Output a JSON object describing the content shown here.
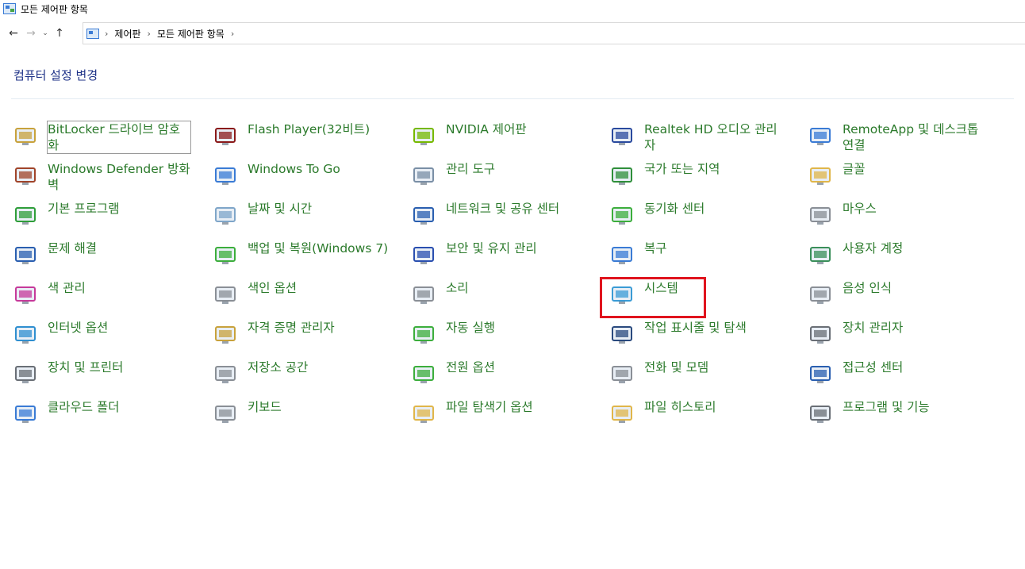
{
  "window": {
    "title": "모든 제어판 항목"
  },
  "nav": {
    "back_glyph": "←",
    "forward_glyph": "→",
    "recent_glyph": "⌄",
    "up_glyph": "↑"
  },
  "breadcrumb": {
    "items": [
      "제어판",
      "모든 제어판 항목"
    ],
    "sep": "›"
  },
  "heading": "컴퓨터 설정 변경",
  "items": [
    {
      "label": "BitLocker 드라이브 암호화",
      "icon": "bitlocker-icon",
      "color": "#c8a23c"
    },
    {
      "label": "Flash Player(32비트)",
      "icon": "flash-icon",
      "color": "#8b1a1a"
    },
    {
      "label": "NVIDIA 제어판",
      "icon": "nvidia-icon",
      "color": "#76b900"
    },
    {
      "label": "Realtek HD 오디오 관리자",
      "icon": "realtek-icon",
      "color": "#2a4a9e"
    },
    {
      "label": "RemoteApp 및 데스크톱 연결",
      "icon": "remoteapp-icon",
      "color": "#3a7bd5"
    },
    {
      "label": "Windows Defender 방화벽",
      "icon": "firewall-icon",
      "color": "#a0442a"
    },
    {
      "label": "Windows To Go",
      "icon": "windows-to-go-icon",
      "color": "#3a7bd5"
    },
    {
      "label": "관리 도구",
      "icon": "admin-tools-icon",
      "color": "#7a8fa6"
    },
    {
      "label": "국가 또는 지역",
      "icon": "region-icon",
      "color": "#2f8f3a"
    },
    {
      "label": "글꼴",
      "icon": "fonts-icon",
      "color": "#e0b64a"
    },
    {
      "label": "기본 프로그램",
      "icon": "default-programs-icon",
      "color": "#2f9e3a"
    },
    {
      "label": "날짜 및 시간",
      "icon": "date-time-icon",
      "color": "#7fa6c9"
    },
    {
      "label": "네트워크 및 공유 센터",
      "icon": "network-icon",
      "color": "#2a5fb0"
    },
    {
      "label": "동기화 센터",
      "icon": "sync-center-icon",
      "color": "#3cae3c"
    },
    {
      "label": "마우스",
      "icon": "mouse-icon",
      "color": "#8a8f96"
    },
    {
      "label": "문제 해결",
      "icon": "troubleshoot-icon",
      "color": "#2a5fb0"
    },
    {
      "label": "백업 및 복원(Windows 7)",
      "icon": "backup-icon",
      "color": "#3cae3c"
    },
    {
      "label": "보안 및 유지 관리",
      "icon": "security-flag-icon",
      "color": "#2a4fb0"
    },
    {
      "label": "복구",
      "icon": "recovery-icon",
      "color": "#3a7bd5"
    },
    {
      "label": "사용자 계정",
      "icon": "user-accounts-icon",
      "color": "#3a8f5a"
    },
    {
      "label": "색 관리",
      "icon": "color-management-icon",
      "color": "#c63a9a"
    },
    {
      "label": "색인 옵션",
      "icon": "indexing-icon",
      "color": "#8a8f96"
    },
    {
      "label": "소리",
      "icon": "sound-icon",
      "color": "#8a8f96"
    },
    {
      "label": "시스템",
      "icon": "system-icon",
      "color": "#3a9bd5"
    },
    {
      "label": "음성 인식",
      "icon": "speech-icon",
      "color": "#8a8f96"
    },
    {
      "label": "인터넷 옵션",
      "icon": "internet-options-icon",
      "color": "#2f8fd0"
    },
    {
      "label": "자격 증명 관리자",
      "icon": "credential-icon",
      "color": "#c8a23c"
    },
    {
      "label": "자동 실행",
      "icon": "autoplay-icon",
      "color": "#3cae3c"
    },
    {
      "label": "작업 표시줄 및 탐색",
      "icon": "taskbar-icon",
      "color": "#2a4a7e"
    },
    {
      "label": "장치 관리자",
      "icon": "device-manager-icon",
      "color": "#6a6f76"
    },
    {
      "label": "장치 및 프린터",
      "icon": "printer-icon",
      "color": "#6a6f76"
    },
    {
      "label": "저장소 공간",
      "icon": "storage-spaces-icon",
      "color": "#8a8f96"
    },
    {
      "label": "전원 옵션",
      "icon": "power-icon",
      "color": "#3cae3c"
    },
    {
      "label": "전화 및 모뎀",
      "icon": "phone-modem-icon",
      "color": "#8a8f96"
    },
    {
      "label": "접근성 센터",
      "icon": "ease-of-access-icon",
      "color": "#2a5fb0"
    },
    {
      "label": "클라우드 폴더",
      "icon": "cloud-folder-icon",
      "color": "#3a7bd5"
    },
    {
      "label": "키보드",
      "icon": "keyboard-icon",
      "color": "#8a8f96"
    },
    {
      "label": "파일 탐색기 옵션",
      "icon": "explorer-options-icon",
      "color": "#e0b64a"
    },
    {
      "label": "파일 히스토리",
      "icon": "file-history-icon",
      "color": "#e0b64a"
    },
    {
      "label": "프로그램 및 기능",
      "icon": "programs-features-icon",
      "color": "#6a6f76"
    }
  ],
  "theme": {
    "link_green": "#2b7a2b",
    "heading_blue": "#1e3287",
    "highlight_red": "#e0141e"
  }
}
